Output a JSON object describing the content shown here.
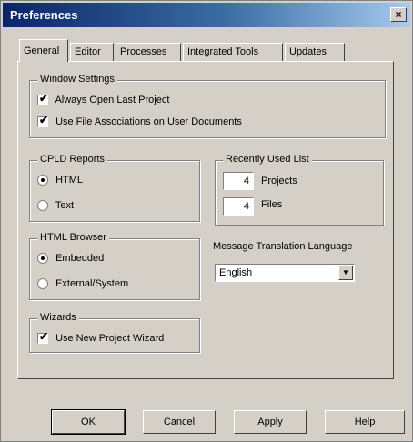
{
  "window": {
    "title": "Preferences",
    "close_glyph": "×"
  },
  "tabs": [
    "General",
    "Editor",
    "Processes",
    "Integrated Tools",
    "Updates"
  ],
  "window_settings": {
    "label": "Window Settings",
    "always_open": {
      "label": "Always Open Last Project",
      "checked": true
    },
    "file_assoc": {
      "label": "Use File Associations on User Documents",
      "checked": true
    }
  },
  "cpld_reports": {
    "label": "CPLD Reports",
    "options": [
      {
        "label": "HTML",
        "selected": true
      },
      {
        "label": "Text",
        "selected": false
      }
    ]
  },
  "recent_list": {
    "label": "Recently Used List",
    "projects": {
      "value": "4",
      "label": "Projects"
    },
    "files": {
      "value": "4",
      "label": "Files"
    }
  },
  "html_browser": {
    "label": "HTML Browser",
    "options": [
      {
        "label": "Embedded",
        "selected": true
      },
      {
        "label": "External/System",
        "selected": false
      }
    ]
  },
  "message_language": {
    "label": "Message Translation Language",
    "value": "English"
  },
  "wizards": {
    "label": "Wizards",
    "new_project": {
      "label": "Use New Project Wizard",
      "checked": true
    }
  },
  "buttons": {
    "ok": "OK",
    "cancel": "Cancel",
    "apply": "Apply",
    "help": "Help"
  },
  "glyphs": {
    "check": "✔",
    "dropdown": "▼"
  }
}
